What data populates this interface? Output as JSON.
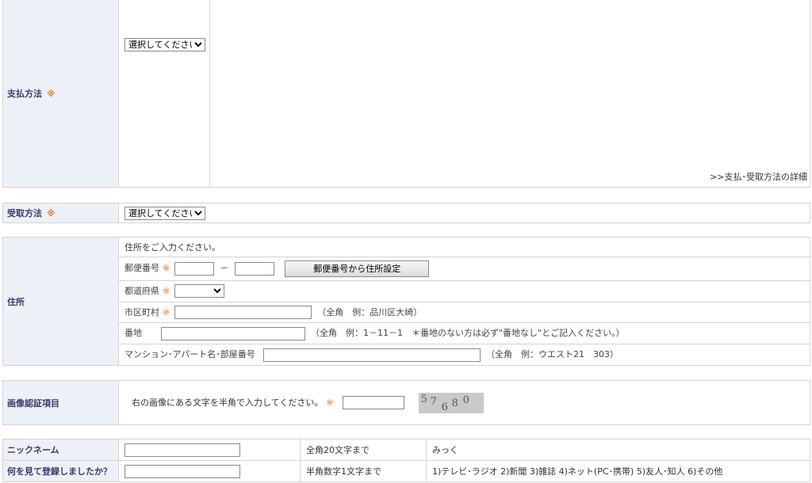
{
  "payment": {
    "label": "支払方法",
    "required_mark": "※",
    "select_value": "選択してください",
    "detail_link": ">>支払･受取方法の詳細"
  },
  "receive": {
    "label": "受取方法",
    "required_mark": "※",
    "select_value": "選択してください"
  },
  "address": {
    "label": "住所",
    "intro": "住所をご入力ください。",
    "postal": {
      "label": "郵便番号",
      "required_mark": "※",
      "dash": "－",
      "button": "郵便番号から住所設定"
    },
    "prefecture": {
      "label": "都道府県",
      "required_mark": "※",
      "select_value": ""
    },
    "city": {
      "label": "市区町村",
      "required_mark": "※",
      "note": "（全角　例：品川区大崎）"
    },
    "street": {
      "label": "番地",
      "note": "（全角　例：1－11－1　＊番地のない方は必ず\"番地なし\"とご記入ください。）"
    },
    "building": {
      "label": "マンション･アパート名･部屋番号",
      "note": "（全角　例：ウエスト21　303）"
    }
  },
  "captcha": {
    "label": "画像認証項目",
    "instruction": "右の画像にある文字を半角で入力してください。",
    "required_mark": "※",
    "chars": [
      "5",
      "7",
      "6",
      "8",
      "0"
    ]
  },
  "nickname": {
    "label": "ニックネーム",
    "rule": "全角20文字まで",
    "example": "みっく"
  },
  "source": {
    "label": "何を見て登録しましたか？",
    "rule": "半角数字1文字まで",
    "options": "1)テレビ･ラジオ 2)新聞 3)雑誌 4)ネット(PC･携帯) 5)友人･知人 6)その他"
  }
}
